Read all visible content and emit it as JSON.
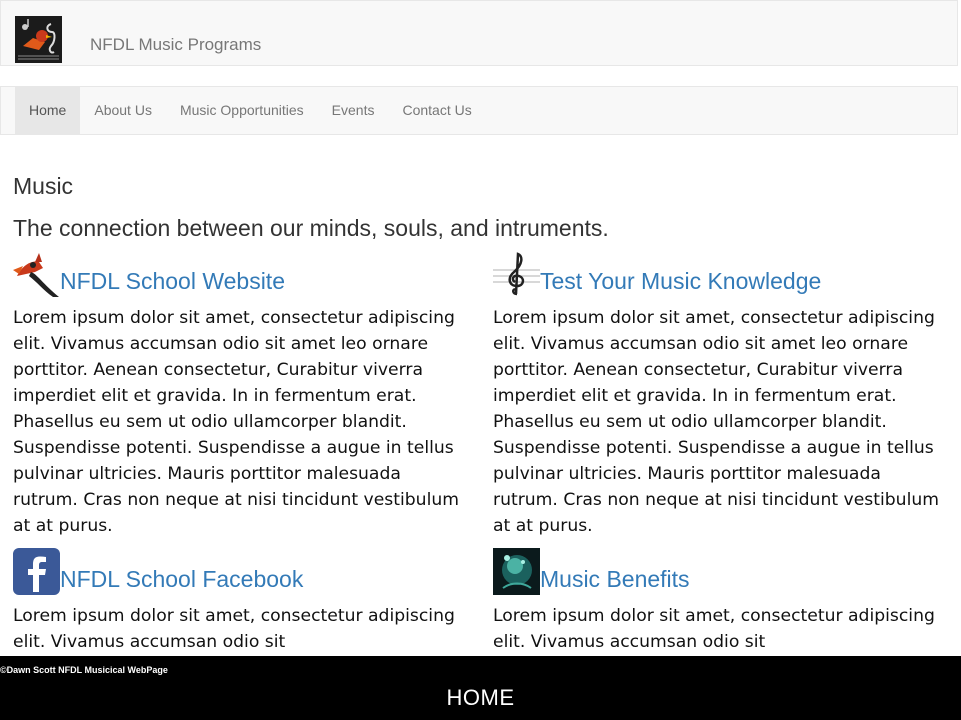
{
  "header": {
    "brand": "NFDL Music Programs",
    "logo_icon": "bird-with-treble-clef-logo"
  },
  "nav": {
    "items": [
      {
        "label": "Home",
        "active": true
      },
      {
        "label": "About Us",
        "active": false
      },
      {
        "label": "Music Opportunities",
        "active": false
      },
      {
        "label": "Events",
        "active": false
      },
      {
        "label": "Contact Us",
        "active": false
      }
    ]
  },
  "main": {
    "heading": "Music",
    "subheading": "The connection between our minds, souls, and intruments.",
    "cards": [
      {
        "title": "NFDL School Website",
        "icon": "cardinal-bird-icon",
        "body": "Lorem ipsum dolor sit amet, consectetur adipiscing elit. Vivamus accumsan odio sit amet leo ornare porttitor. Aenean consectetur, Curabitur viverra imperdiet elit et gravida. In in fermentum erat. Phasellus eu sem ut odio ullamcorper blandit. Suspendisse potenti. Suspendisse a augue in tellus pulvinar ultricies. Mauris porttitor malesuada rutrum. Cras non neque at nisi tincidunt vestibulum at at purus."
      },
      {
        "title": "Test Your Music Knowledge",
        "icon": "treble-clef-icon",
        "body": "Lorem ipsum dolor sit amet, consectetur adipiscing elit. Vivamus accumsan odio sit amet leo ornare porttitor. Aenean consectetur, Curabitur viverra imperdiet elit et gravida. In in fermentum erat. Phasellus eu sem ut odio ullamcorper blandit. Suspendisse potenti. Suspendisse a augue in tellus pulvinar ultricies. Mauris porttitor malesuada rutrum. Cras non neque at nisi tincidunt vestibulum at at purus."
      },
      {
        "title": "NFDL School Facebook",
        "icon": "facebook-icon",
        "body": "Lorem ipsum dolor sit amet, consectetur adipiscing elit. Vivamus accumsan odio sit"
      },
      {
        "title": "Music Benefits",
        "icon": "glowing-brain-icon",
        "body": "Lorem ipsum dolor sit amet, consectetur adipiscing elit. Vivamus accumsan odio sit"
      }
    ]
  },
  "footer": {
    "credit": "©Dawn Scott NFDL Musicical WebPage",
    "home_label": "HOME"
  },
  "colors": {
    "link": "#337ab7",
    "navbar_bg": "#f8f8f8",
    "footer_bg": "#000000"
  }
}
